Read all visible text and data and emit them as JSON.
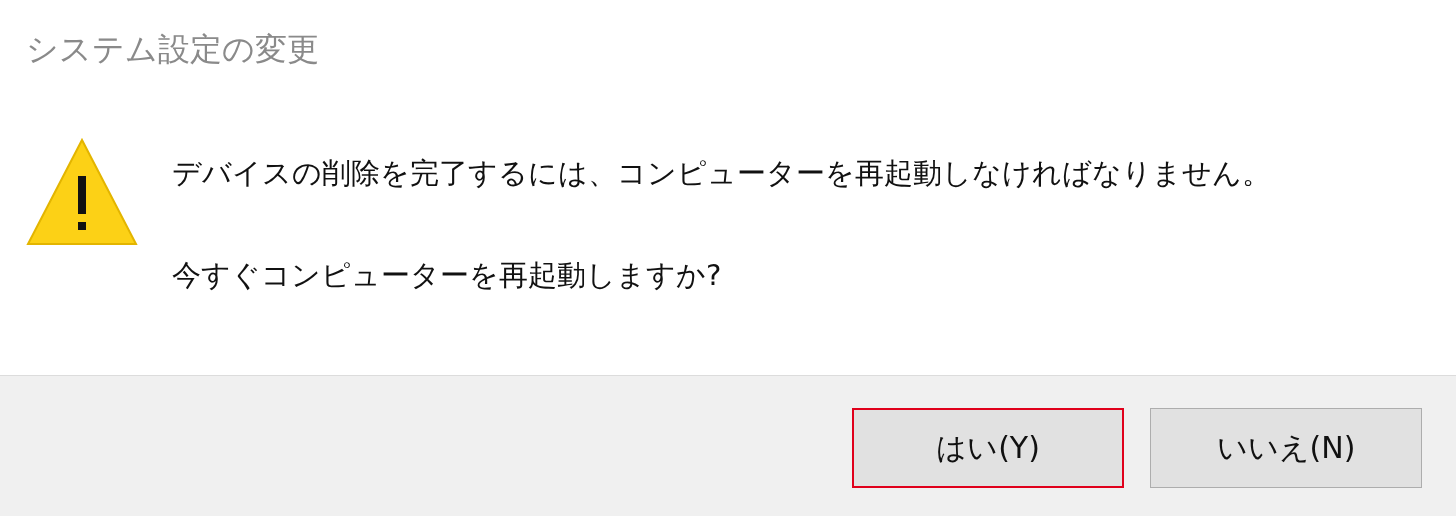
{
  "window": {
    "title": "システム設定の変更"
  },
  "message": {
    "lines": [
      "デバイスの削除を完了するには、コンピューターを再起動しなければなりません。",
      "今すぐコンピューターを再起動しますか?"
    ]
  },
  "buttons": [
    {
      "label": "はい(Y)",
      "highlighted": true
    },
    {
      "label": "いいえ(N)",
      "highlighted": false
    }
  ]
}
